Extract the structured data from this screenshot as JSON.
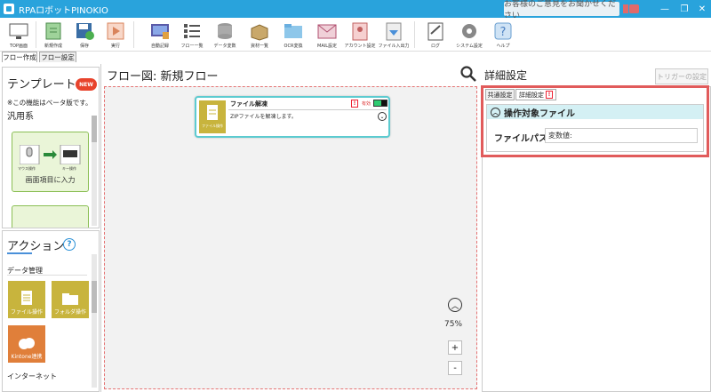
{
  "window": {
    "title": "RPAロボットPINOKIO",
    "feedback_label": "お客様のご意見をお聞かせください",
    "min": "—",
    "max": "❐",
    "close": "✕"
  },
  "toolbar": {
    "items": [
      {
        "label": "TOP画面",
        "icon": "monitor-icon"
      },
      {
        "label": "新規作成",
        "icon": "new-doc-icon"
      },
      {
        "label": "保存",
        "icon": "save-icon"
      },
      {
        "label": "実行",
        "icon": "play-icon"
      },
      {
        "label": "自動記録",
        "icon": "record-icon"
      },
      {
        "label": "フロー一覧",
        "icon": "list-icon"
      },
      {
        "label": "データ変数",
        "icon": "database-icon"
      },
      {
        "label": "資材一覧",
        "icon": "box-icon"
      },
      {
        "label": "OCR変換",
        "icon": "folder-icon"
      },
      {
        "label": "MAIL設定",
        "icon": "mail-icon"
      },
      {
        "label": "アカウント設定",
        "icon": "account-icon"
      },
      {
        "label": "ファイル入出力",
        "icon": "file-io-icon"
      },
      {
        "label": "ログ",
        "icon": "log-icon"
      },
      {
        "label": "システム設定",
        "icon": "gear-icon"
      },
      {
        "label": "ヘルプ",
        "icon": "help-icon"
      }
    ]
  },
  "top_tabs": [
    "フロー作成",
    "フロー設定"
  ],
  "left": {
    "template_title": "テンプレート",
    "new_badge": "NEW",
    "beta_note": "※この機能はベータ版です。",
    "category": "汎用系",
    "template_card_label": "画面項目に入力",
    "mouse_label": "マウス操作",
    "key_label": "キー操作",
    "action_title": "アクション",
    "action_help": "?",
    "action_category": "データ管理",
    "actions": [
      "ファイル操作",
      "フォルダ操作",
      "Kintone連携"
    ],
    "next_category": "インターネット"
  },
  "center": {
    "title": "フロー図:  新規フロー",
    "node": {
      "title": "ファイル解凍",
      "desc": "ZIPファイルを解凍します。",
      "icon_label": "ファイル操作",
      "warn": "!",
      "enabled": "有効"
    },
    "zoom": "75%",
    "zoom_in": "+",
    "zoom_out": "-"
  },
  "right": {
    "title": "詳細設定",
    "trigger_label": "トリガーの設定",
    "tabs": [
      "共通設定",
      "詳細設定"
    ],
    "tab_warn": "!",
    "section_title": "操作対象ファイル",
    "field_label": "ファイルパス",
    "field_value": "変数値:"
  }
}
